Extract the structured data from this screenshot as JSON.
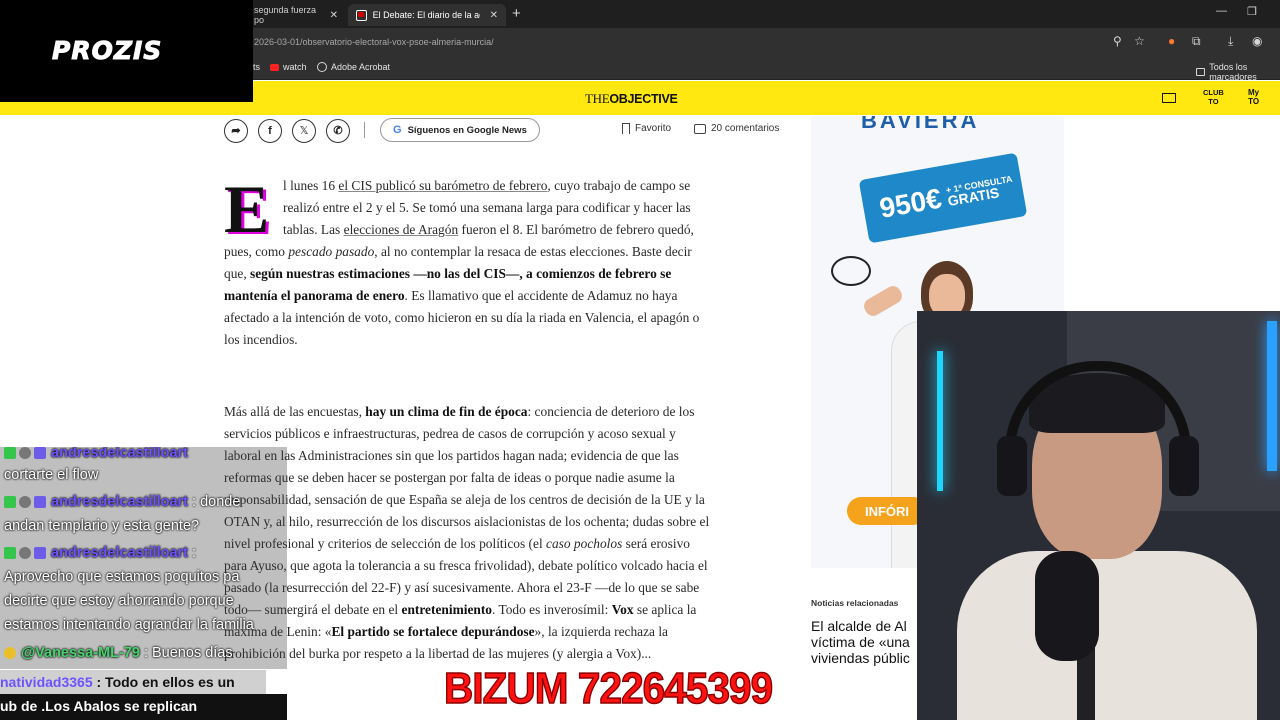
{
  "browser": {
    "tabs": [
      {
        "label": "segunda fuerza po"
      },
      {
        "label": "El Debate: El diario de la actuali"
      }
    ],
    "url": "2026-03-01/observatorio-electoral-vox-psoe-almeria-murcia/",
    "bookmarks": [
      {
        "label": "ts"
      },
      {
        "label": "watch"
      },
      {
        "label": "Adobe Acrobat"
      }
    ],
    "bookmarks_folder": "Todos los marcadores"
  },
  "site": {
    "logo_the": "THE",
    "logo_objective": "OBJECTIVE",
    "club_line1": "CLUB",
    "club_line2": "TO",
    "my_line1": "My",
    "my_line2": "TO"
  },
  "share": {
    "google_news": "Síguenos en Google News",
    "favorite": "Favorito",
    "comments": "20 comentarios"
  },
  "article": {
    "dropcap": "E",
    "p1": {
      "l1a": "l lunes 16 ",
      "l1b": "el CIS publicó su barómetro de febrero",
      "l1c": ", cuyo trabajo de campo se",
      "l2": "realizó entre el 2 y el 5. Se tomó una semana larga para codificar y hacer las",
      "l3a": "tablas. Las ",
      "l3b": "elecciones de Aragón",
      "l3c": " fueron el 8. El barómetro de febrero quedó,",
      "l4a": "pues, como ",
      "l4b": "pescado pasado",
      "l4c": ", al no contemplar la resaca de estas elecciones. Baste decir",
      "l5a": "que, ",
      "l5b": "según nuestras estimaciones —no las del CIS—, a comienzos de febrero se",
      "l6a": "mantenía el panorama de enero",
      "l6b": ". Es llamativo que el accidente de Adamuz no haya",
      "l7": "afectado a la intención de voto, como hicieron en su día la riada en Valencia, el apagón o",
      "l8": "los incendios."
    },
    "p2": {
      "l1a": "Más allá de las encuestas, ",
      "l1b": "hay un clima de fin de época",
      "l1c": ": conciencia de deterioro de los",
      "l2": "servicios públicos e infraestructuras, pedrea de casos de corrupción y acoso sexual y",
      "l3": "laboral en las Administraciones sin que los partidos hagan nada; evidencia de que las",
      "l4": "reformas que se deben hacer se postergan por falta de ideas o porque nadie asume la",
      "l5": "responsabilidad, sensación de que España se aleja de los centros de decisión de la UE y la",
      "l6": "OTAN y, al hilo, resurrección de los discursos aislacionistas de los ochenta; dudas sobre el",
      "l7a": "nivel profesional y criterios de selección de los políticos (el ",
      "l7b": "caso pocholos",
      "l7c": " será erosivo",
      "l8": "para Ayuso, que agota la tolerancia a su fresca frivolidad), debate político volcado hacia el",
      "l9": "pasado (la resurrección del 22-F) y así sucesivamente. Ahora el 23-F —de lo que se sabe",
      "l10a": "todo— sumergirá el debate en el ",
      "l10b": "entretenimiento",
      "l10c": ". Todo es inverosímil: ",
      "l10d": "Vox",
      "l10e": " se aplica la",
      "l11a": "máxima de Lenin: «",
      "l11b": "El partido se fortalece depurándose",
      "l11c": "», la izquierda rechaza la",
      "l12": "prohibición del burka por respeto a la libertad de las mujeres (y alergia a Vox)..."
    }
  },
  "ad": {
    "brand_top": "BAVIERA",
    "price": "950€",
    "promo_line1": "+ 1ª CONSULTA",
    "promo_line2": "GRATIS",
    "button": "INFÓRI"
  },
  "related": {
    "title": "Noticias relacionadas",
    "l1": "El alcalde de Al",
    "l2": "víctima de «una",
    "l3": "viviendas públic"
  },
  "overlay": {
    "sponsor": "PROZIS",
    "chat": [
      {
        "user": "andresdelcastilloart",
        "text": ": Pa... cortarte el flow"
      },
      {
        "user": "andresdelcastilloart",
        "text": ": donde",
        "text2": "andan templario y esta gente?"
      },
      {
        "user": "andresdelcastilloart",
        "text": ":",
        "text2": "Aprovecho que estamos poquitos pa",
        "text3": "decirte que estoy ahorrando porque",
        "text4": "estamos intentando agrandar la familia"
      },
      {
        "user": "@Vanessa-ML-79",
        "text": ": Buenos días"
      }
    ],
    "ticker_user": "natividad3365",
    "ticker_text": ": Todo en ellos es un",
    "ticker2_text": "ub de .Los Abalos se replican",
    "bizum": "BIZUM 722645399"
  }
}
